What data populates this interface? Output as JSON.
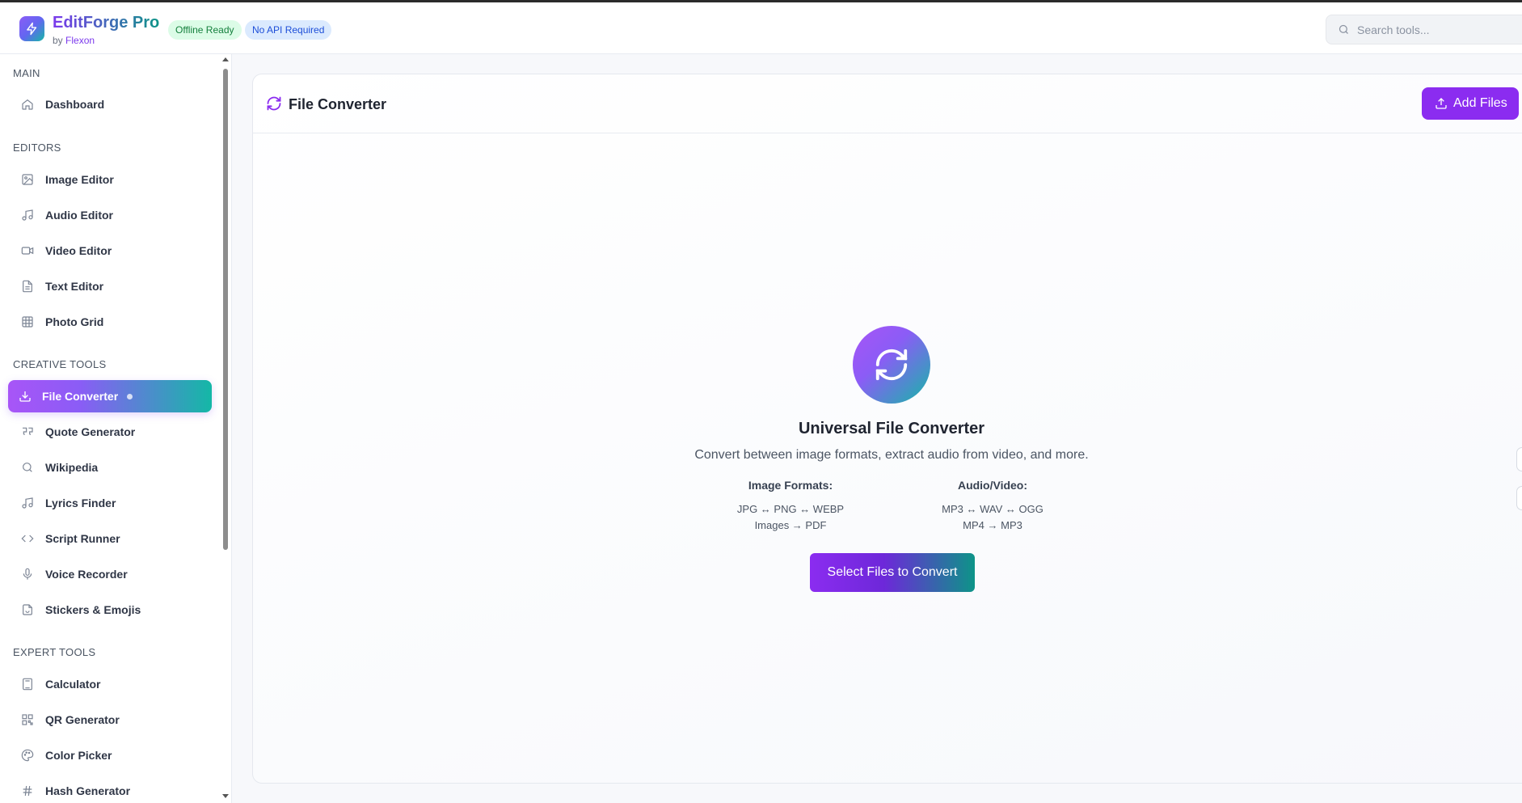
{
  "header": {
    "app_title": "EditForge Pro",
    "by_prefix": "by",
    "brand": "Flexon",
    "badges": [
      "Offline Ready",
      "No API Required"
    ],
    "search_placeholder": "Search tools..."
  },
  "sidebar": {
    "sections": [
      {
        "label": "MAIN",
        "items": [
          {
            "label": "Dashboard",
            "icon": "home-icon"
          }
        ]
      },
      {
        "label": "EDITORS",
        "items": [
          {
            "label": "Image Editor",
            "icon": "image-icon"
          },
          {
            "label": "Audio Editor",
            "icon": "music-icon"
          },
          {
            "label": "Video Editor",
            "icon": "video-icon"
          },
          {
            "label": "Text Editor",
            "icon": "file-text-icon"
          },
          {
            "label": "Photo Grid",
            "icon": "grid-icon"
          }
        ]
      },
      {
        "label": "CREATIVE TOOLS",
        "items": [
          {
            "label": "File Converter",
            "icon": "download-icon",
            "active": true
          },
          {
            "label": "Quote Generator",
            "icon": "quote-icon"
          },
          {
            "label": "Wikipedia",
            "icon": "search-icon"
          },
          {
            "label": "Lyrics Finder",
            "icon": "music-icon"
          },
          {
            "label": "Script Runner",
            "icon": "code-icon"
          },
          {
            "label": "Voice Recorder",
            "icon": "mic-icon"
          },
          {
            "label": "Stickers & Emojis",
            "icon": "sticker-icon"
          }
        ]
      },
      {
        "label": "EXPERT TOOLS",
        "items": [
          {
            "label": "Calculator",
            "icon": "calculator-icon"
          },
          {
            "label": "QR Generator",
            "icon": "qr-icon"
          },
          {
            "label": "Color Picker",
            "icon": "palette-icon"
          },
          {
            "label": "Hash Generator",
            "icon": "hash-icon"
          }
        ]
      }
    ]
  },
  "main": {
    "title": "File Converter",
    "add_button": "Add Files",
    "hero_title": "Universal File Converter",
    "hero_description": "Convert between image formats, extract audio from video, and more.",
    "image_formats": {
      "heading": "Image Formats:",
      "lines": [
        "JPG ↔ PNG ↔ WEBP",
        "Images → PDF"
      ]
    },
    "audio_video": {
      "heading": "Audio/Video:",
      "lines": [
        "MP3 ↔ WAV ↔ OGG",
        "MP4 → MP3"
      ]
    },
    "select_button": "Select Files to Convert"
  },
  "colors": {
    "accent": "#8b2cf0",
    "teal": "#14b8a6",
    "offline_badge_bg": "#dcfce7",
    "api_badge_bg": "#dbeafe"
  }
}
